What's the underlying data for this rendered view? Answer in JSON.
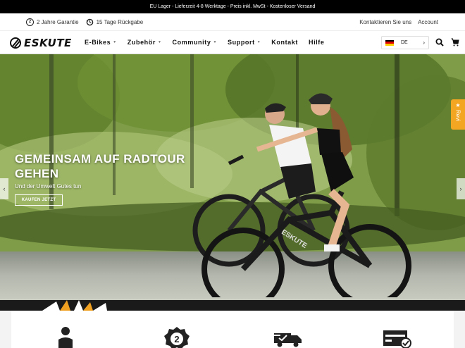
{
  "topbar": {
    "text": "EU Lager - Lieferzeit 4-8 Werktage - Preis inkl. MwSt - Kostenloser Versand"
  },
  "infobar": {
    "guarantee": "2 Jahre Garantie",
    "returns": "15 Tage Rückgabe",
    "contact": "Kontaktieren Sie uns",
    "account": "Account"
  },
  "nav": {
    "logo": "ESKUTE",
    "items": [
      {
        "label": "E-Bikes",
        "dropdown": true
      },
      {
        "label": "Zubehör",
        "dropdown": true
      },
      {
        "label": "Community",
        "dropdown": true
      },
      {
        "label": "Support",
        "dropdown": true
      },
      {
        "label": "Kontakt",
        "dropdown": false
      },
      {
        "label": "Hilfe",
        "dropdown": false
      }
    ],
    "language": "DE"
  },
  "hero": {
    "title": "GEMEINSAM AUF RADTOUR GEHEN",
    "subtitle": "Und der Umwelt Gutes tun",
    "cta": "KAUFEN JETZT",
    "bike_brand": "ESKUTE"
  },
  "review_tab": {
    "label": "Revi"
  },
  "icons": {
    "search": "search-icon",
    "cart": "cart-icon",
    "guarantee": "shield-2-icon",
    "returns": "return-icon",
    "prev": "chevron-left-icon",
    "next": "chevron-right-icon",
    "star": "star-icon"
  }
}
